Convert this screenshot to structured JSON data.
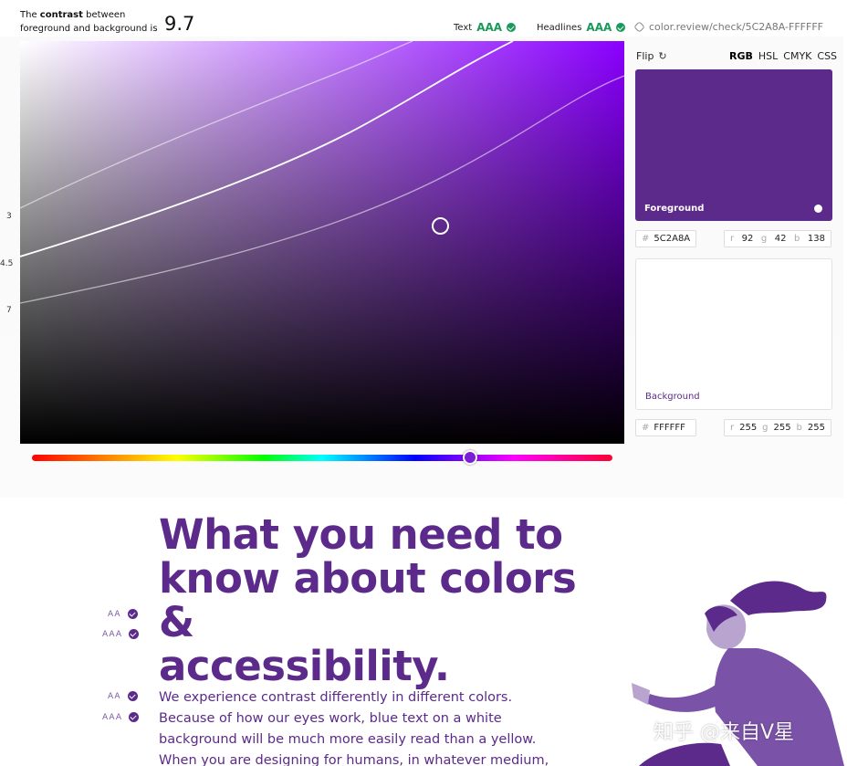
{
  "header": {
    "label_prefix": "The",
    "label_bold": "contrast",
    "label_suffix": "between",
    "label_line2": "foreground and background is",
    "contrast_value": "9.7",
    "text_label": "Text",
    "text_level": "AAA",
    "headlines_label": "Headlines",
    "headlines_level": "AAA",
    "share_url": "color.review/check/5C2A8A-FFFFFF"
  },
  "picker": {
    "ratio_labels": [
      "3",
      "4.5",
      "7"
    ],
    "hue_color": "#8a00ff"
  },
  "controls": {
    "flip_label": "Flip",
    "modes": [
      "RGB",
      "HSL",
      "CMYK",
      "CSS"
    ],
    "active_mode": "RGB"
  },
  "foreground": {
    "label": "Foreground",
    "color": "#5C2A8A",
    "hex_prefix": "#",
    "hex": "5C2A8A",
    "r_label": "r",
    "r": "92",
    "g_label": "g",
    "g": "42",
    "b_label": "b",
    "b": "138"
  },
  "background": {
    "label": "Background",
    "color": "#FFFFFF",
    "hex_prefix": "#",
    "hex": "FFFFFF",
    "r_label": "r",
    "r": "255",
    "g_label": "g",
    "g": "255",
    "b_label": "b",
    "b": "255"
  },
  "article": {
    "heading_lines": [
      "What you need to",
      "know about colors &",
      "accessibility."
    ],
    "heading_marks": [
      "AA",
      "AAA"
    ],
    "paragraph_marks": [
      "AA",
      "AAA"
    ],
    "paragraph": "We experience contrast differently in different colors. Because of how our eyes work, blue text on a white background will be much more easily read than a yellow. When you are designing for humans, in whatever medium, this is something to always"
  },
  "watermark": "知乎 @来自V星"
}
